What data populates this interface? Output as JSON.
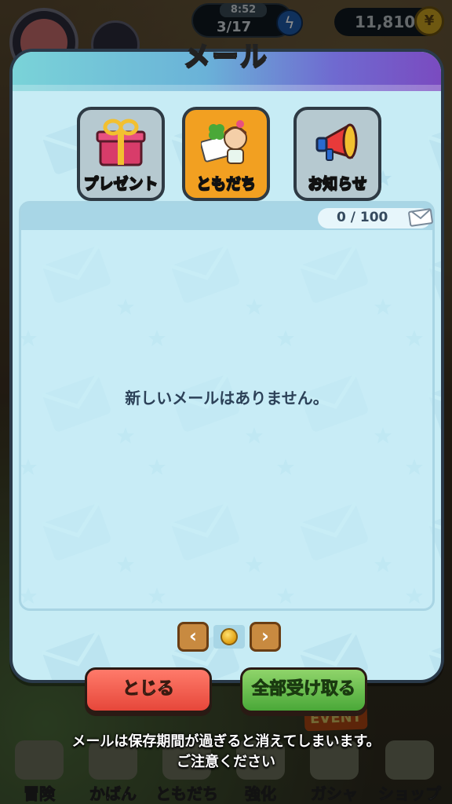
{
  "hud": {
    "stamina_time": "8:52",
    "stamina_count": "3/17",
    "coins": "11,810"
  },
  "dialog": {
    "title": "メール",
    "tabs": [
      {
        "label": "プレゼント",
        "icon": "gift-icon",
        "active": false
      },
      {
        "label": "ともだち",
        "icon": "friend-icon",
        "active": true
      },
      {
        "label": "お知らせ",
        "icon": "megaphone-icon",
        "active": false
      }
    ],
    "counter": "0 / 100",
    "empty_message": "新しいメールはありません。",
    "pager": {
      "prev": "‹",
      "next": "›",
      "current_page": 1,
      "total_pages": 1
    },
    "close_label": "とじる",
    "receive_all_label": "全部受け取る",
    "notice": {
      "line1": "メールは保存期間が過ぎると消えてしまいます。",
      "line2": "ご注意ください"
    }
  },
  "bottom_nav": {
    "items": [
      {
        "label": "冒険"
      },
      {
        "label": "かばん"
      },
      {
        "label": "ともだち"
      },
      {
        "label": "強化"
      },
      {
        "label": "ガシャ"
      },
      {
        "label": "ショップ"
      }
    ],
    "event_badge": "EVENT"
  },
  "colors": {
    "active_tab": "#f2a021",
    "inactive_tab": "#b6c9d0",
    "close_button": "#e6473a",
    "receive_button": "#4aa838",
    "panel_bg": "#c7ecf5"
  }
}
